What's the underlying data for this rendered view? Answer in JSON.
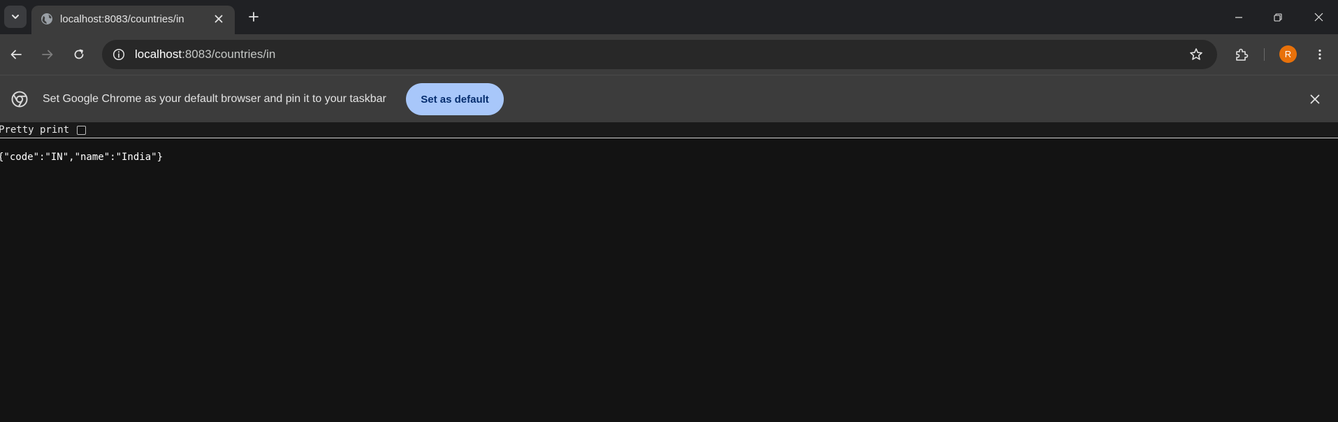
{
  "browser": {
    "tab": {
      "title": "localhost:8083/countries/in",
      "favicon": "globe-icon"
    },
    "address_bar": {
      "url_host": "localhost",
      "url_rest": ":8083/countries/in"
    },
    "profile": {
      "initial": "R",
      "color": "#e8710a"
    }
  },
  "infobar": {
    "message": "Set Google Chrome as your default browser and pin it to your taskbar",
    "button_label": "Set as default"
  },
  "page": {
    "pretty_print_label": "Pretty print",
    "pretty_print_checked": false,
    "json_body": "{\"code\":\"IN\",\"name\":\"India\"}"
  },
  "colors": {
    "tab_strip": "#202124",
    "toolbar": "#3c3c3c",
    "accent_button": "#a8c7fa",
    "page_background": "#131313"
  }
}
